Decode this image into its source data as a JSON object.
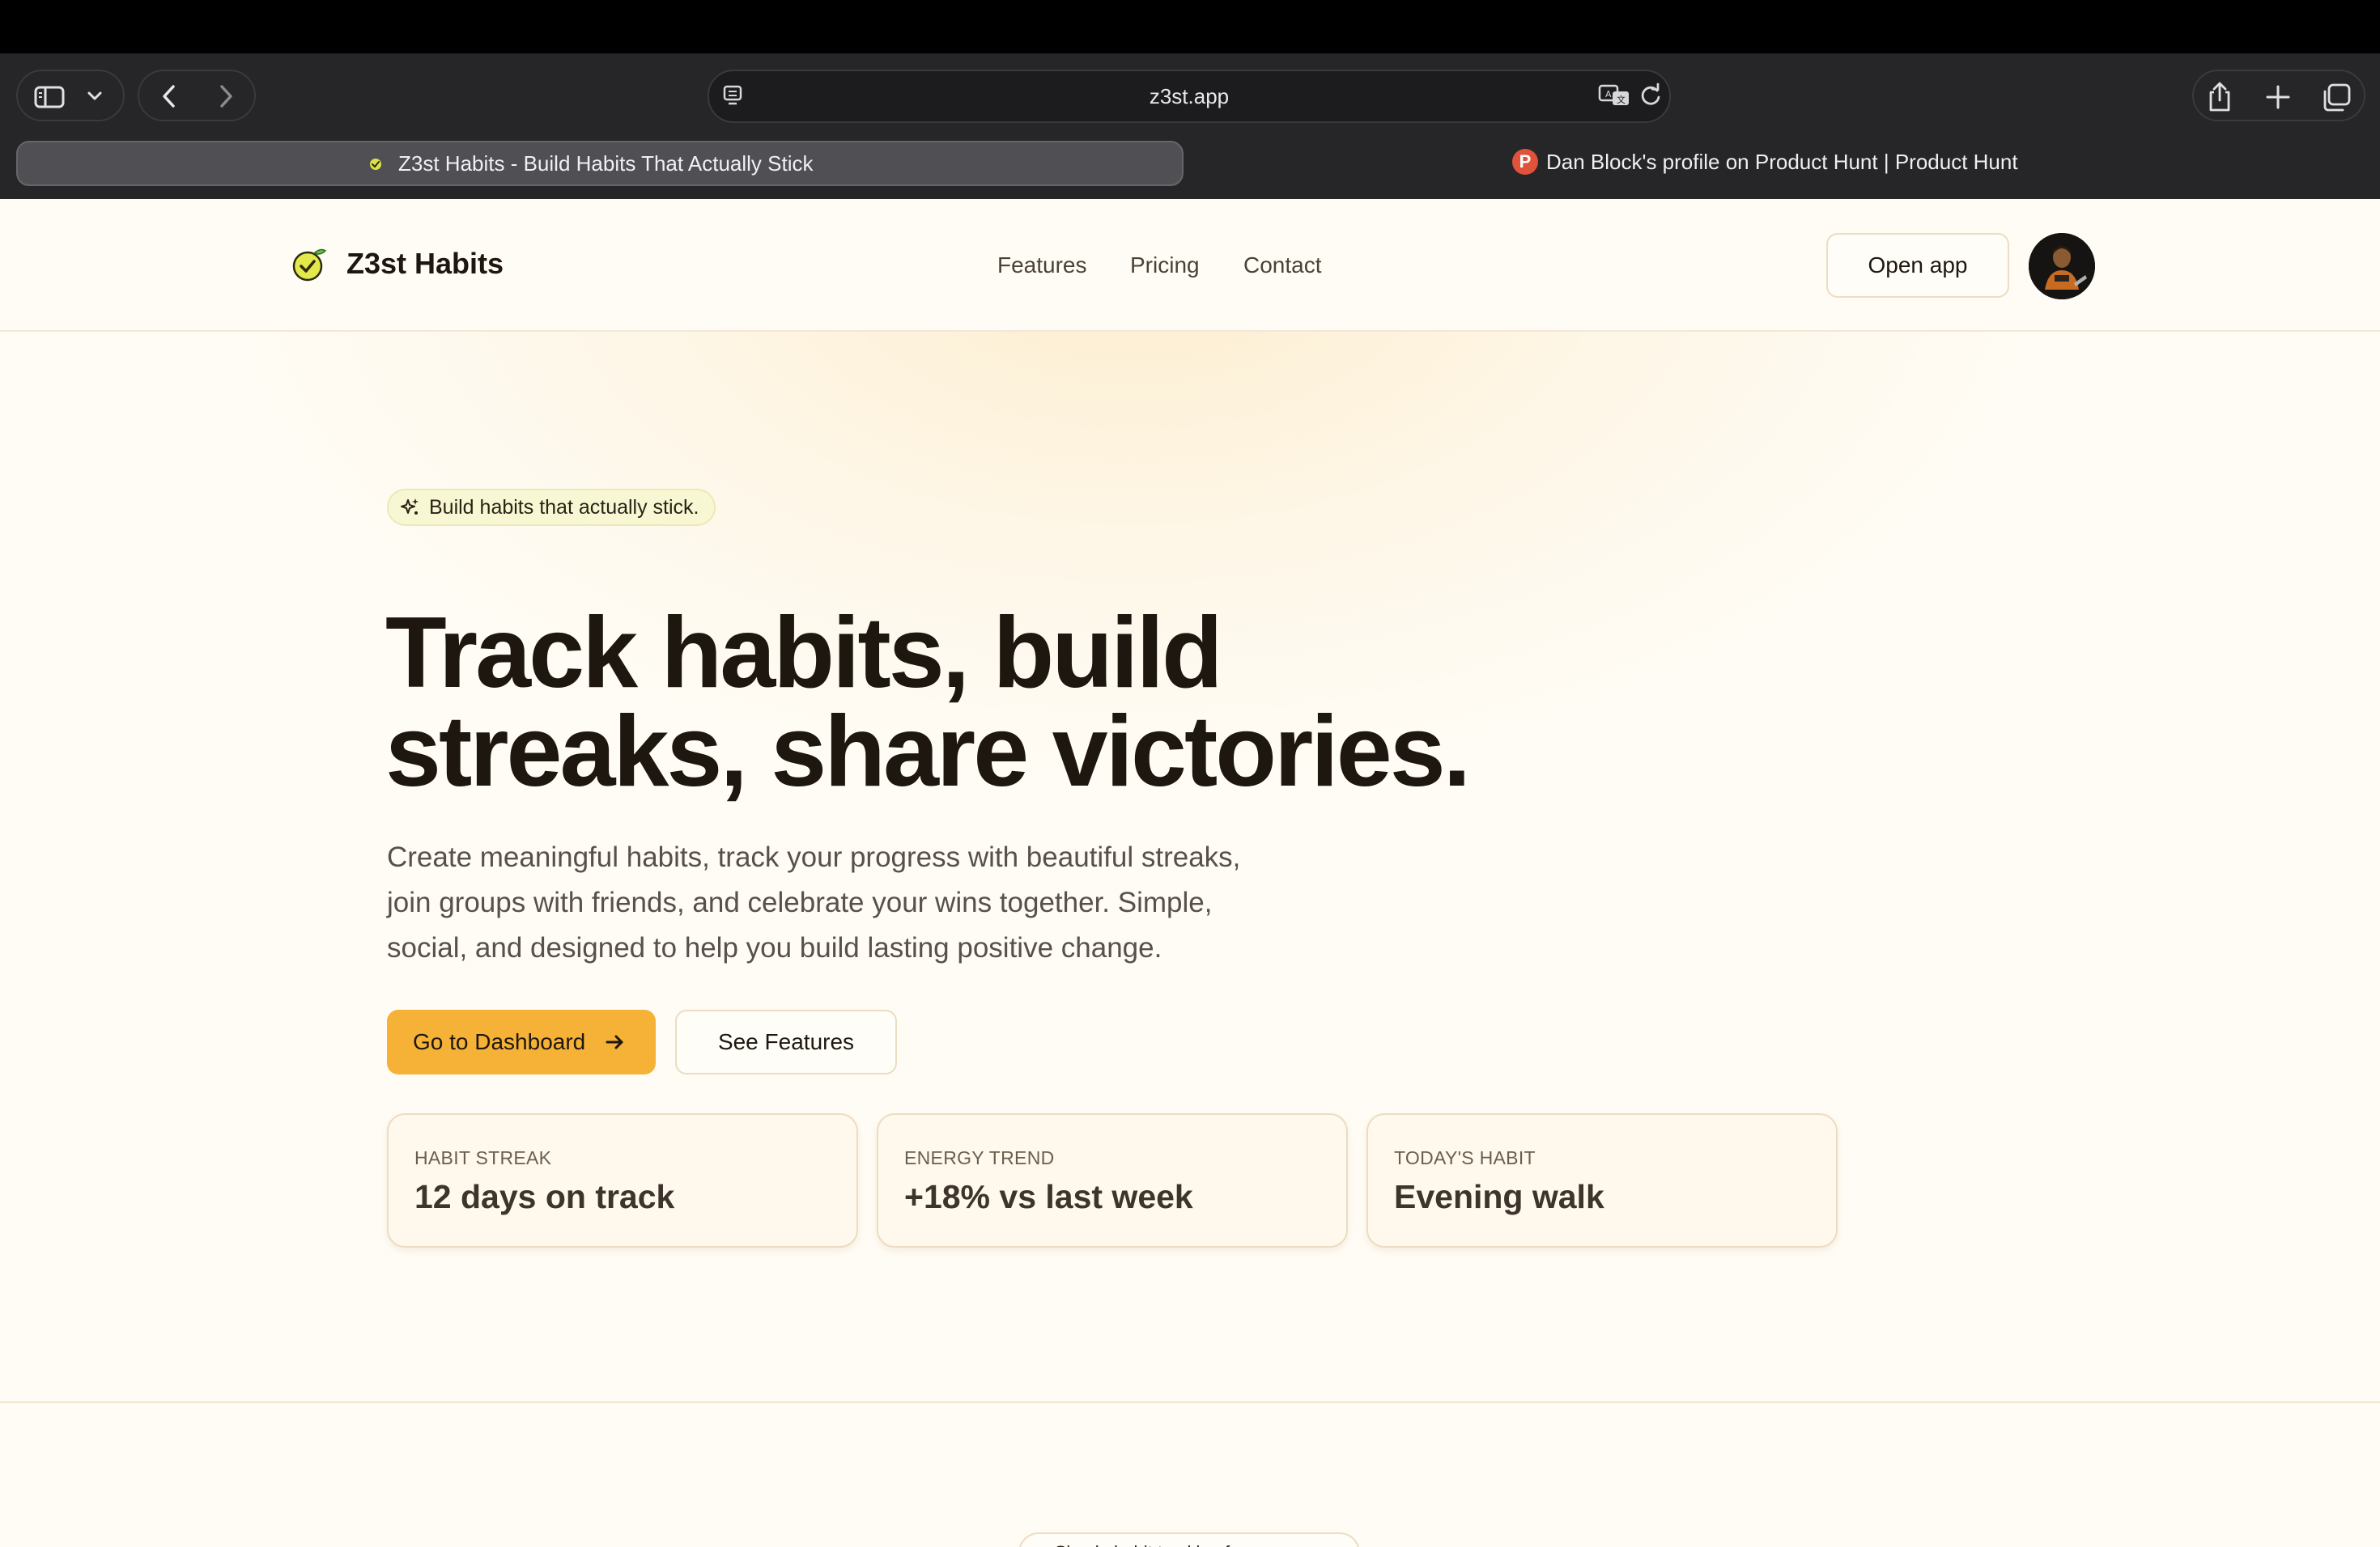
{
  "browser": {
    "address": "z3st.app",
    "tabs": [
      {
        "title": "Z3st Habits - Build Habits That Actually Stick",
        "active": true
      },
      {
        "title": "Dan Block's profile on Product Hunt | Product Hunt",
        "active": false,
        "favicon_letter": "P"
      }
    ]
  },
  "header": {
    "logo_text": "Z3st Habits",
    "nav": [
      "Features",
      "Pricing",
      "Contact"
    ],
    "open_app": "Open app"
  },
  "hero": {
    "badge": "Build habits that actually stick.",
    "headline_line1": "Track habits, build",
    "headline_line2": "streaks, share victories.",
    "subcopy_line1": "Create meaningful habits, track your progress with beautiful streaks,",
    "subcopy_line2": "join groups with friends, and celebrate your wins together. Simple,",
    "subcopy_line3": "social, and designed to help you build lasting positive change.",
    "primary_cta": "Go to Dashboard",
    "secondary_cta": "See Features"
  },
  "stats": [
    {
      "label": "HABIT STREAK",
      "value": "12 days on track"
    },
    {
      "label": "ENERGY TREND",
      "value": "+18% vs last week"
    },
    {
      "label": "TODAY'S HABIT",
      "value": "Evening walk"
    }
  ],
  "next_section": {
    "badge": "Simple habit tracking for everyone"
  },
  "colors": {
    "accent": "#f5b237",
    "page_bg": "#fffcf5",
    "text": "#1e1710",
    "chrome_bg": "#262628"
  },
  "icons": [
    "sidebar-icon",
    "chevron-down-icon",
    "back-icon",
    "forward-icon",
    "reader-icon",
    "translate-icon",
    "reload-icon",
    "share-icon",
    "new-tab-icon",
    "tab-overview-icon",
    "sparkle-icon",
    "arrow-right-icon",
    "logo-check-icon"
  ]
}
